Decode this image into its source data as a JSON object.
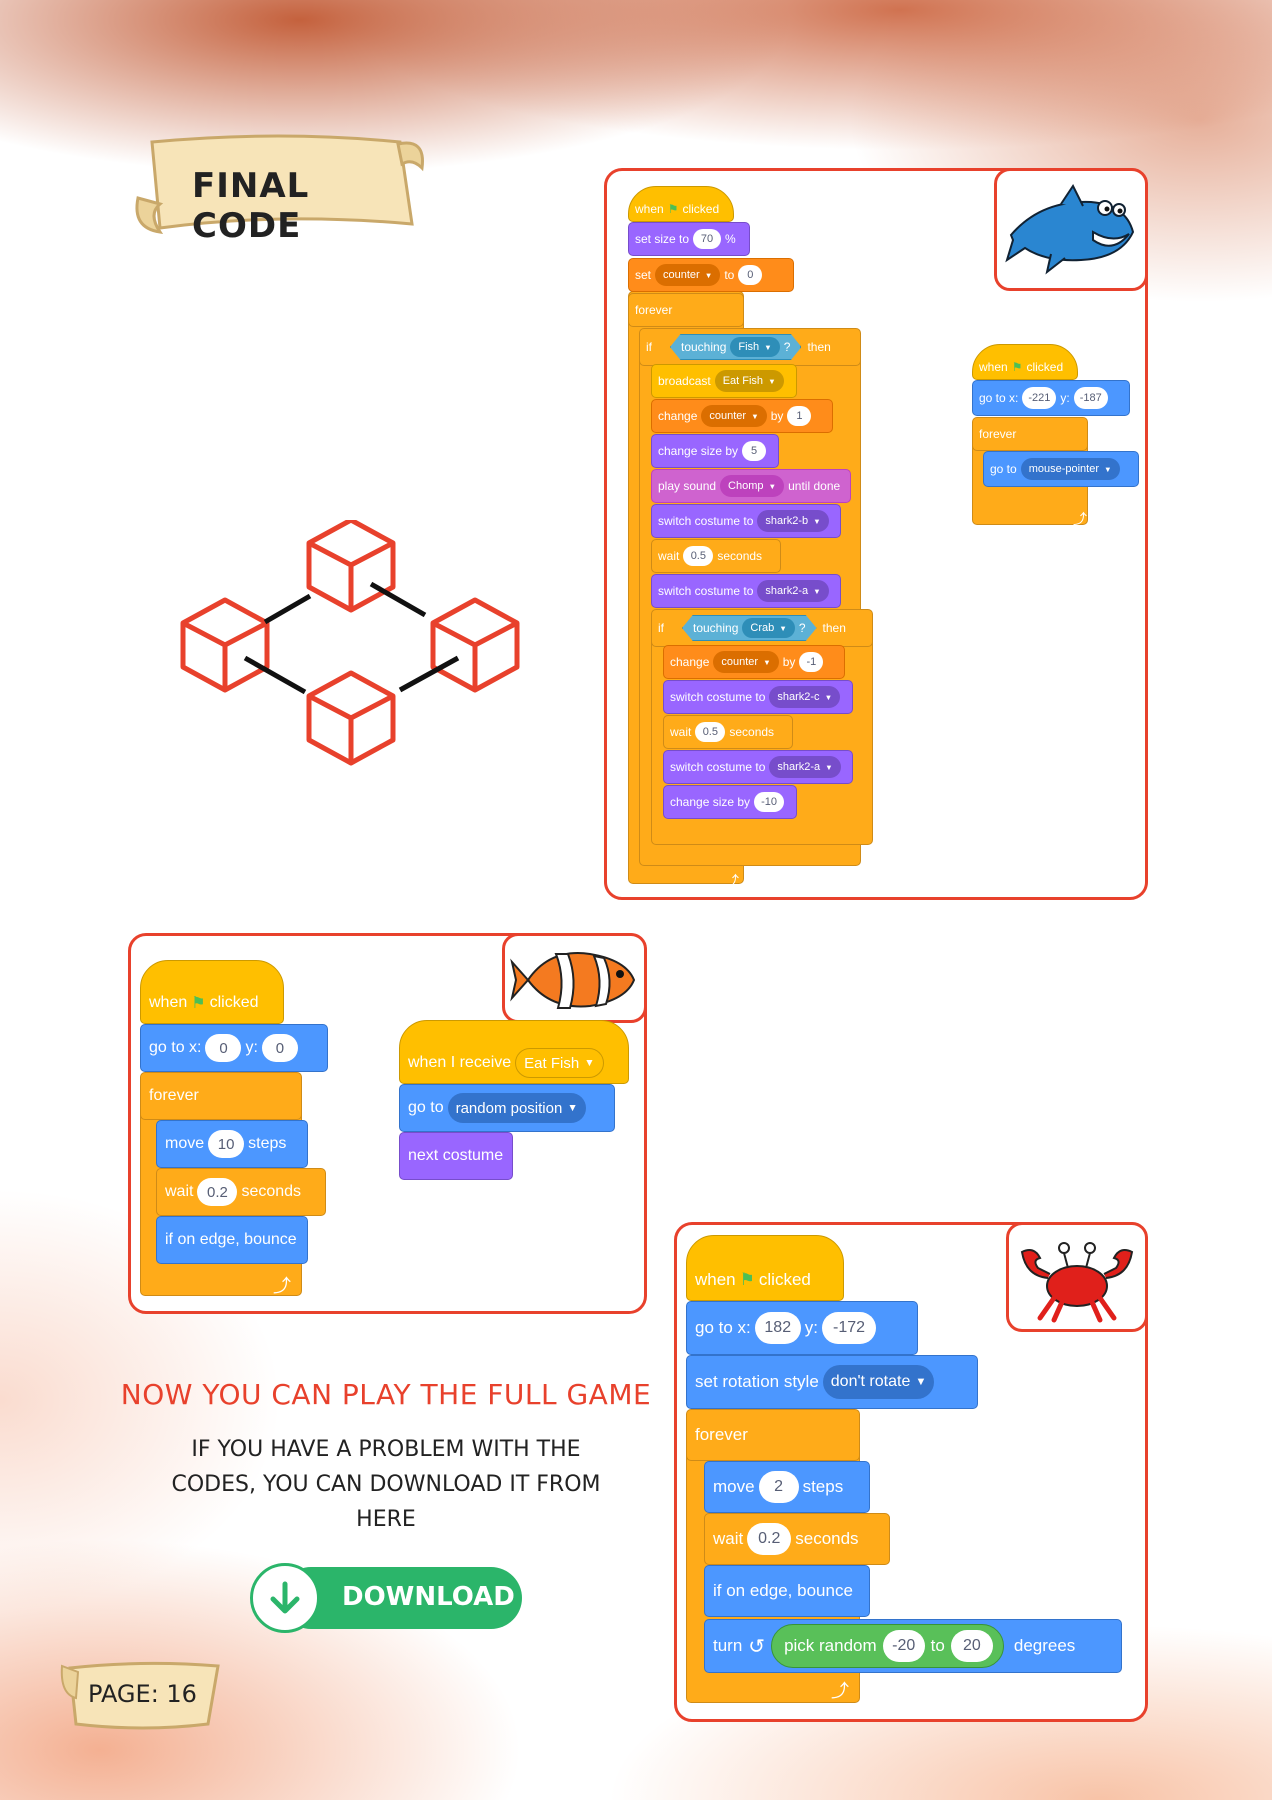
{
  "header": {
    "title": "FINAL CODE"
  },
  "footer": {
    "page": "PAGE: 16"
  },
  "cta": {
    "heading": "NOW YOU CAN PLAY THE FULL GAME",
    "line1": "IF YOU HAVE A PROBLEM WITH THE",
    "line2": "CODES, YOU CAN DOWNLOAD IT FROM",
    "line3": "HERE",
    "download": "DOWNLOAD"
  },
  "common": {
    "when": "when",
    "clicked": "clicked",
    "forever": "forever",
    "if": "if",
    "then": "then",
    "touching": "touching",
    "q": "?",
    "x": "go to x:",
    "y": "y:",
    "to": "to",
    "by": "by",
    "seconds": "seconds",
    "wait": "wait",
    "steps": "steps",
    "move": "move",
    "change": "change",
    "set": "set",
    "switch_costume": "switch costume to",
    "change_size": "change size by",
    "edge": "if on edge, bounce",
    "goto": "go to",
    "turn": "turn",
    "degrees": "degrees",
    "pick_random": "pick random",
    "percent": "%",
    "set_size": "set size to",
    "broadcast": "broadcast",
    "play_sound": "play sound",
    "until_done": "until done",
    "when_receive": "when I receive",
    "next_costume": "next costume",
    "set_rotation": "set rotation style",
    "arrow": "↺"
  },
  "shark": {
    "size": "70",
    "counter_var": "counter",
    "counter_init": "0",
    "fish": "Fish",
    "eat_fish": "Eat Fish",
    "inc": "1",
    "size_inc": "5",
    "sound": "Chomp",
    "costume_b": "shark2-b",
    "wait1": "0.5",
    "costume_a": "shark2-a",
    "crab": "Crab",
    "dec": "-1",
    "costume_c": "shark2-c",
    "wait2": "0.5",
    "costume_a2": "shark2-a",
    "size_dec": "-10",
    "goto_x": "-221",
    "goto_y": "-187",
    "mouse": "mouse-pointer"
  },
  "fish": {
    "x": "0",
    "y": "0",
    "steps": "10",
    "wait": "0.2",
    "msg": "Eat Fish",
    "random": "random position"
  },
  "crab": {
    "x": "182",
    "y": "-172",
    "rotate": "don't rotate",
    "steps": "2",
    "wait": "0.2",
    "r1": "-20",
    "r2": "20"
  },
  "colors": {
    "accent": "#e8412c",
    "download": "#2bb56a"
  }
}
